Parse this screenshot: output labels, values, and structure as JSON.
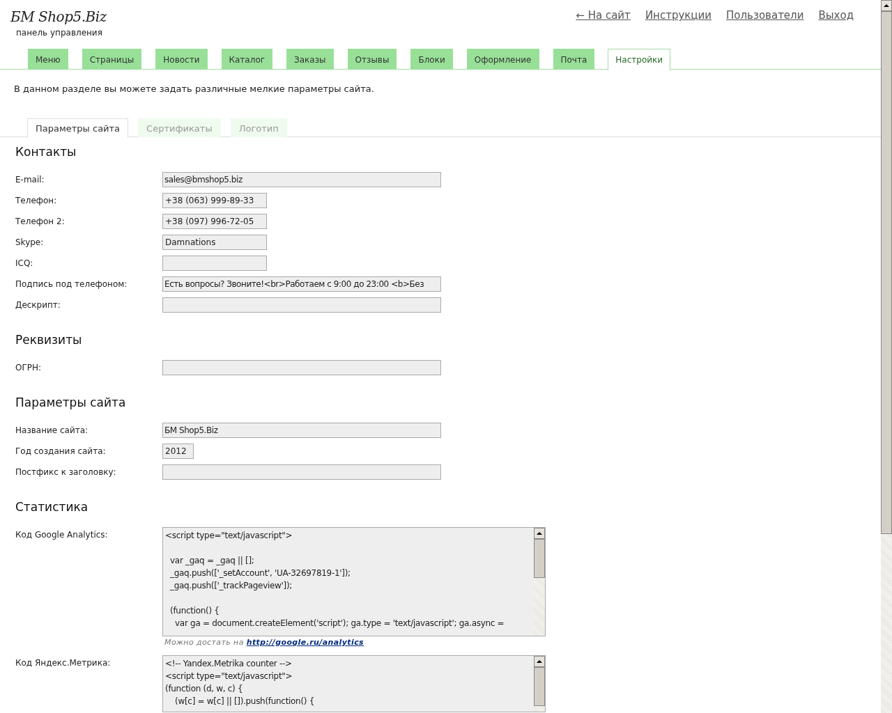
{
  "header": {
    "logo": "БМ Shop5.Biz",
    "subtitle": "панель управления",
    "links": [
      "← На сайт",
      "Инструкции",
      "Пользователи",
      "Выход"
    ]
  },
  "tabs": [
    {
      "label": "Меню",
      "selected": false
    },
    {
      "label": "Страницы",
      "selected": false
    },
    {
      "label": "Новости",
      "selected": false
    },
    {
      "label": "Каталог",
      "selected": false
    },
    {
      "label": "Заказы",
      "selected": false
    },
    {
      "label": "Отзывы",
      "selected": false
    },
    {
      "label": "Блоки",
      "selected": false
    },
    {
      "label": "Оформление",
      "selected": false
    },
    {
      "label": "Почта",
      "selected": false
    },
    {
      "label": "Настройки",
      "selected": true
    }
  ],
  "intro": "В данном разделе вы можете задать различные мелкие параметры сайта.",
  "subtabs": [
    {
      "label": "Параметры сайта",
      "selected": true
    },
    {
      "label": "Сертификаты",
      "selected": false
    },
    {
      "label": "Логотип",
      "selected": false
    }
  ],
  "sections": [
    {
      "title": "Контакты",
      "fields": [
        {
          "label": "E-mail:",
          "kind": "wide",
          "value": "sales@bmshop5.biz"
        },
        {
          "label": "Телефон:",
          "kind": "narrow",
          "value": "+38 (063) 999-89-33"
        },
        {
          "label": "Телефон 2:",
          "kind": "narrow",
          "value": "+38 (097) 996-72-05"
        },
        {
          "label": "Skype:",
          "kind": "narrow",
          "value": "Damnations"
        },
        {
          "label": "ICQ:",
          "kind": "narrow"
        },
        {
          "label": "Подпись под телефоном:",
          "kind": "wide",
          "value": "Есть вопросы? Звоните!<br>Работаем с 9:00 до 23:00 <b>Без"
        },
        {
          "label": "Дескрипт:",
          "kind": "wide"
        }
      ]
    },
    {
      "title": "Реквизиты",
      "fields": [
        {
          "label": "ОГРН:",
          "kind": "wide"
        }
      ]
    },
    {
      "title": "Параметры сайта",
      "fields": [
        {
          "label": "Название сайта:",
          "kind": "wide",
          "value": "БМ Shop5.Biz"
        },
        {
          "label": "Год создания сайта:",
          "kind": "small",
          "value": "2012"
        },
        {
          "label": "Постфикс к заголовку:",
          "kind": "wide"
        }
      ]
    },
    {
      "title": "Статистика",
      "fields": [
        {
          "label": "Код Google Analytics:",
          "kind": "code",
          "value": "<script type=\"text/javascript\">\n\n  var _gaq = _gaq || [];\n  _gaq.push(['_setAccount', 'UA-32697819-1']);\n  _gaq.push(['_trackPageview']);\n\n  (function() {\n    var ga = document.createElement('script'); ga.type = 'text/javascript'; ga.async =",
          "hint": "Можно достать на",
          "hint_link": "http://google.ru/analytics"
        },
        {
          "label": "Код Яндекс.Метрика:",
          "kind": "code",
          "value": "<!-- Yandex.Metrika counter -->\n<script type=\"text/javascript\">\n(function (d, w, c) {\n    (w[c] = w[c] || []).push(function() {"
        }
      ]
    }
  ]
}
